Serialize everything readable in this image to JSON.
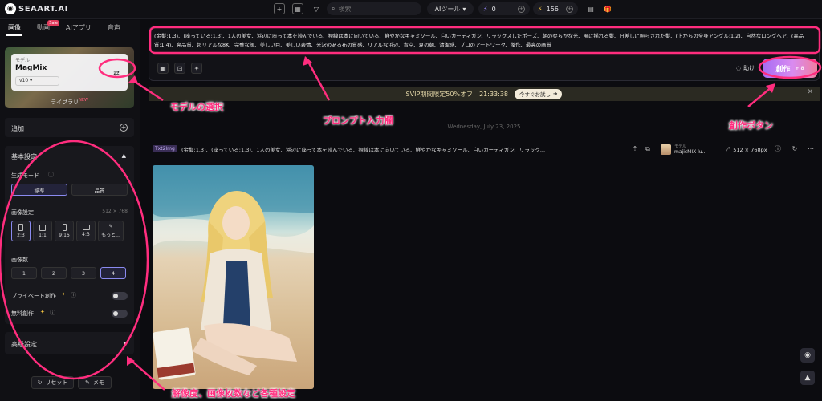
{
  "app": {
    "logo_text": "SEAART.AI"
  },
  "topbar": {
    "search_placeholder": "検索",
    "ai_tool_label": "AIツール",
    "energy_value": "0",
    "stamina_value": "156"
  },
  "sidebar": {
    "tabs": [
      {
        "label": "画像"
      },
      {
        "label": "動画",
        "badge": "Sale"
      },
      {
        "label": "AIアプリ"
      },
      {
        "label": "音声"
      }
    ],
    "model": {
      "tag": "モデル",
      "name": "MagMix",
      "version": "v10",
      "library_label": "ライブラリ",
      "library_badge": "NEW"
    },
    "add_label": "追加",
    "basic_settings": "基本設定",
    "gen_mode_label": "生成モード",
    "gen_modes": [
      "標準",
      "品質"
    ],
    "image_settings_label": "画像設定",
    "image_size": "512 × 768",
    "ratios": [
      "2:3",
      "1:1",
      "9:16",
      "4:3",
      "もっと..."
    ],
    "image_count_label": "画像数",
    "image_counts": [
      "1",
      "2",
      "3",
      "4"
    ],
    "private_label": "プライベート創作",
    "free_label": "無料創作",
    "advanced_label": "高級設定",
    "reset_label": "リセット",
    "memo_label": "メモ"
  },
  "prompt": {
    "text": "(金髪:1.3)、(座っている:1.3)、1人の美女、浜辺に座って本を読んでいる、視線は本に向いている、鮮やかなキャミソール、白いカーディガン、リラックスしたポーズ、朝の柔らかな光、風に揺れる髪、日差しに照らされた髪、(上からの全身アングル:1.2)、自然なロングヘア、(高品質:1.4)、高品質、超リアルな8K、完璧な顔、美しい目、美しい表情、光沢のある布の質感、リアルな浜辺、青空、夏の朝、清潔感、プロのアートワーク、傑作、最高の画質",
    "help_label": "助け",
    "create_label": "創作",
    "create_cost": "+ 8"
  },
  "banner": {
    "text": "SVIP期間限定50%オフ",
    "timer": "21:33:38",
    "button_label": "今すぐお試し"
  },
  "feed": {
    "date": "Wednesday, July 23, 2025",
    "mode": "Txt2Img",
    "prompt": "(金髪:1.3)、(座っている:1.3)、1人の美女、浜辺に座って本を読んでいる、視線は本に向いている、鮮やかなキャミソール、白いカーディガン、リラック...",
    "model_label": "モデル",
    "model_name": "majicMIX lu...",
    "resolution": "512 × 768px"
  },
  "annotations": {
    "model_select": "モデルの選択",
    "prompt_field": "プロンプト入力欄",
    "create_button": "創作ボタン",
    "settings": "解像度、画像枚数など各種設定"
  },
  "colors": {
    "annotation": "#ff2d7e",
    "accent": "#a66cf4"
  }
}
